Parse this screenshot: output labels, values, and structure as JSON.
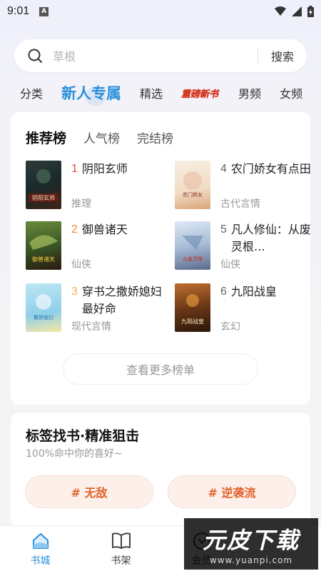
{
  "status": {
    "time": "9:01",
    "indicator": "A"
  },
  "search": {
    "placeholder": "草根",
    "button": "搜索"
  },
  "top_tabs": [
    "分类",
    "新人专属",
    "精选",
    "男频",
    "女频"
  ],
  "promo_tab": "重磅新书",
  "ranking": {
    "tabs": [
      "推荐榜",
      "人气榜",
      "完结榜"
    ],
    "books": [
      {
        "rank": "1",
        "title": "阴阳玄师",
        "category": "推理"
      },
      {
        "rank": "2",
        "title": "御兽诸天",
        "category": "仙侠"
      },
      {
        "rank": "3",
        "title": "穿书之撒娇媳妇最好命",
        "category": "现代言情"
      },
      {
        "rank": "4",
        "title": "农门娇女有点田",
        "category": "古代言情"
      },
      {
        "rank": "5",
        "title": "凡人修仙：从废灵根…",
        "category": "仙侠"
      },
      {
        "rank": "6",
        "title": "九阳战皇",
        "category": "玄幻"
      }
    ],
    "more_button": "查看更多榜单"
  },
  "tags": {
    "title": "标签找书·精准狙击",
    "subtitle": "100%命中你的喜好~",
    "pills": [
      "# 无敌",
      "# 逆袭流"
    ]
  },
  "bottom_nav": [
    {
      "label": "书城",
      "icon": "bookstore-icon"
    },
    {
      "label": "书架",
      "icon": "bookshelf-icon"
    },
    {
      "label": "会员",
      "icon": "member-icon"
    }
  ],
  "watermark": {
    "main": "元皮下载",
    "url": "www.yuanpi.com"
  },
  "colors": {
    "accent": "#2a8fdc",
    "rank1": "#e94a3c",
    "rank2": "#f08c2a",
    "rank3": "#f3b14a",
    "tag": "#e2602a"
  }
}
